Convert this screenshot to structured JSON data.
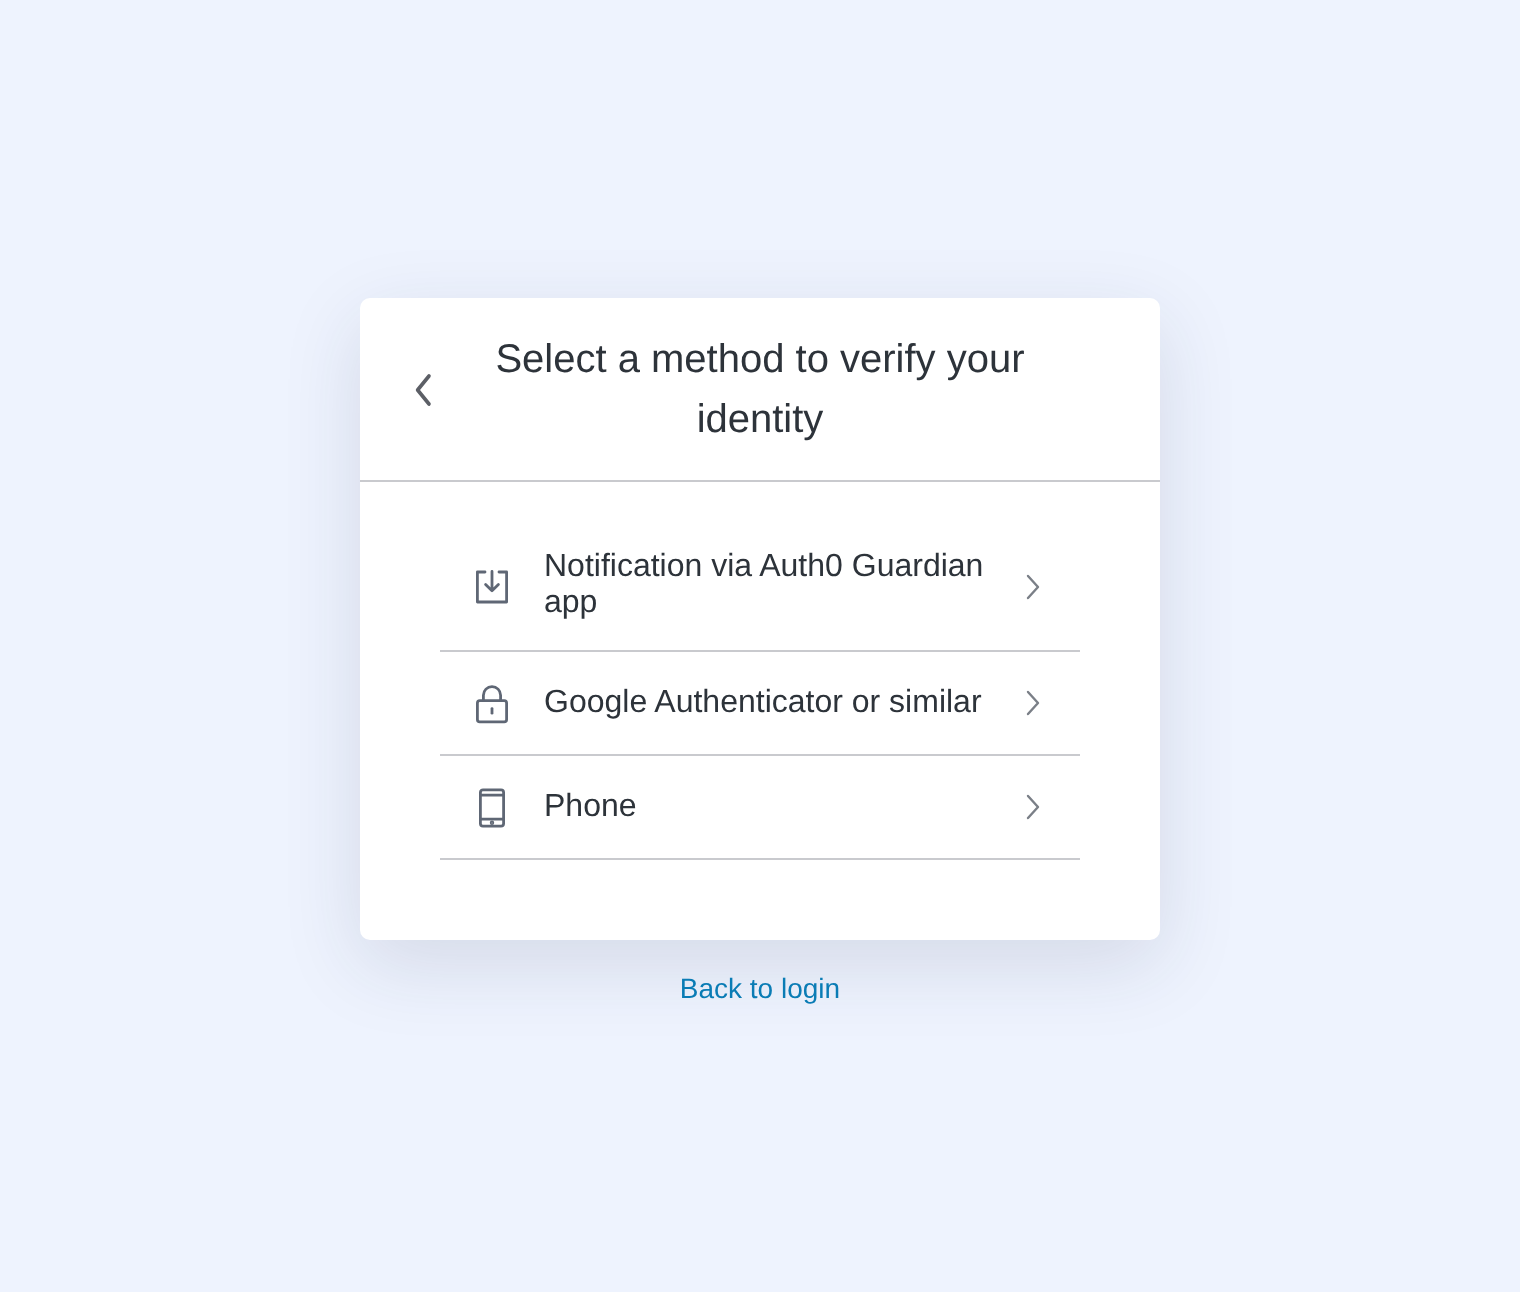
{
  "header": {
    "title": "Select a method to verify your identity"
  },
  "methods": [
    {
      "kind": "push",
      "label": "Notification via Auth0 Guardian app"
    },
    {
      "kind": "otp",
      "label": "Google Authenticator or similar"
    },
    {
      "kind": "phone",
      "label": "Phone"
    }
  ],
  "footer": {
    "link": "Back to login"
  }
}
